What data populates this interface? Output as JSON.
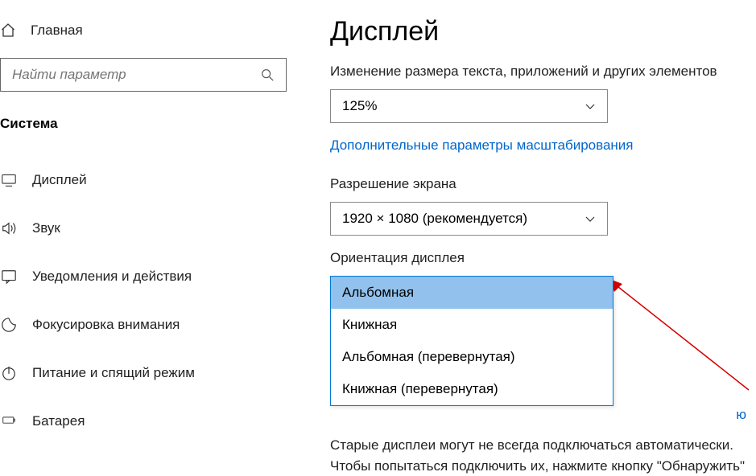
{
  "sidebar": {
    "home_label": "Главная",
    "search_placeholder": "Найти параметр",
    "section_title": "Система",
    "items": [
      {
        "label": "Дисплей"
      },
      {
        "label": "Звук"
      },
      {
        "label": "Уведомления и действия"
      },
      {
        "label": "Фокусировка внимания"
      },
      {
        "label": "Питание и спящий режим"
      },
      {
        "label": "Батарея"
      }
    ]
  },
  "main": {
    "title": "Дисплей",
    "scale_label": "Изменение размера текста, приложений и других элементов",
    "scale_value": "125%",
    "advanced_scaling_link": "Дополнительные параметры масштабирования",
    "resolution_label": "Разрешение экрана",
    "resolution_value": "1920 × 1080 (рекомендуется)",
    "orientation_label": "Ориентация дисплея",
    "orientation_options": [
      "Альбомная",
      "Книжная",
      "Альбомная (перевернутая)",
      "Книжная (перевернутая)"
    ],
    "link_partial": "ю",
    "footer_text": "Старые дисплеи могут не всегда подключаться автоматически. Чтобы попытаться подключить их, нажмите кнопку \"Обнаружить\""
  }
}
